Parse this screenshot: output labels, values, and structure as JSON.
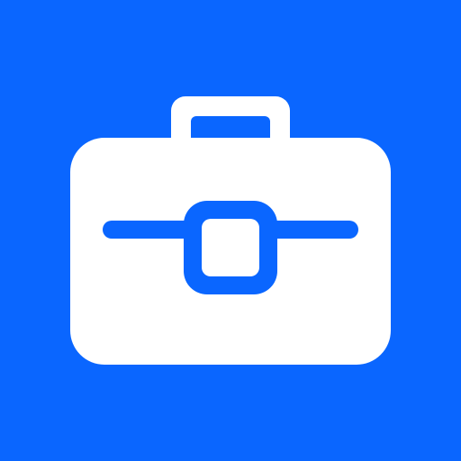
{
  "app_icon": {
    "icon": "briefcase-icon",
    "colors": {
      "background": "#0A66FF",
      "foreground": "#FFFFFF"
    }
  }
}
